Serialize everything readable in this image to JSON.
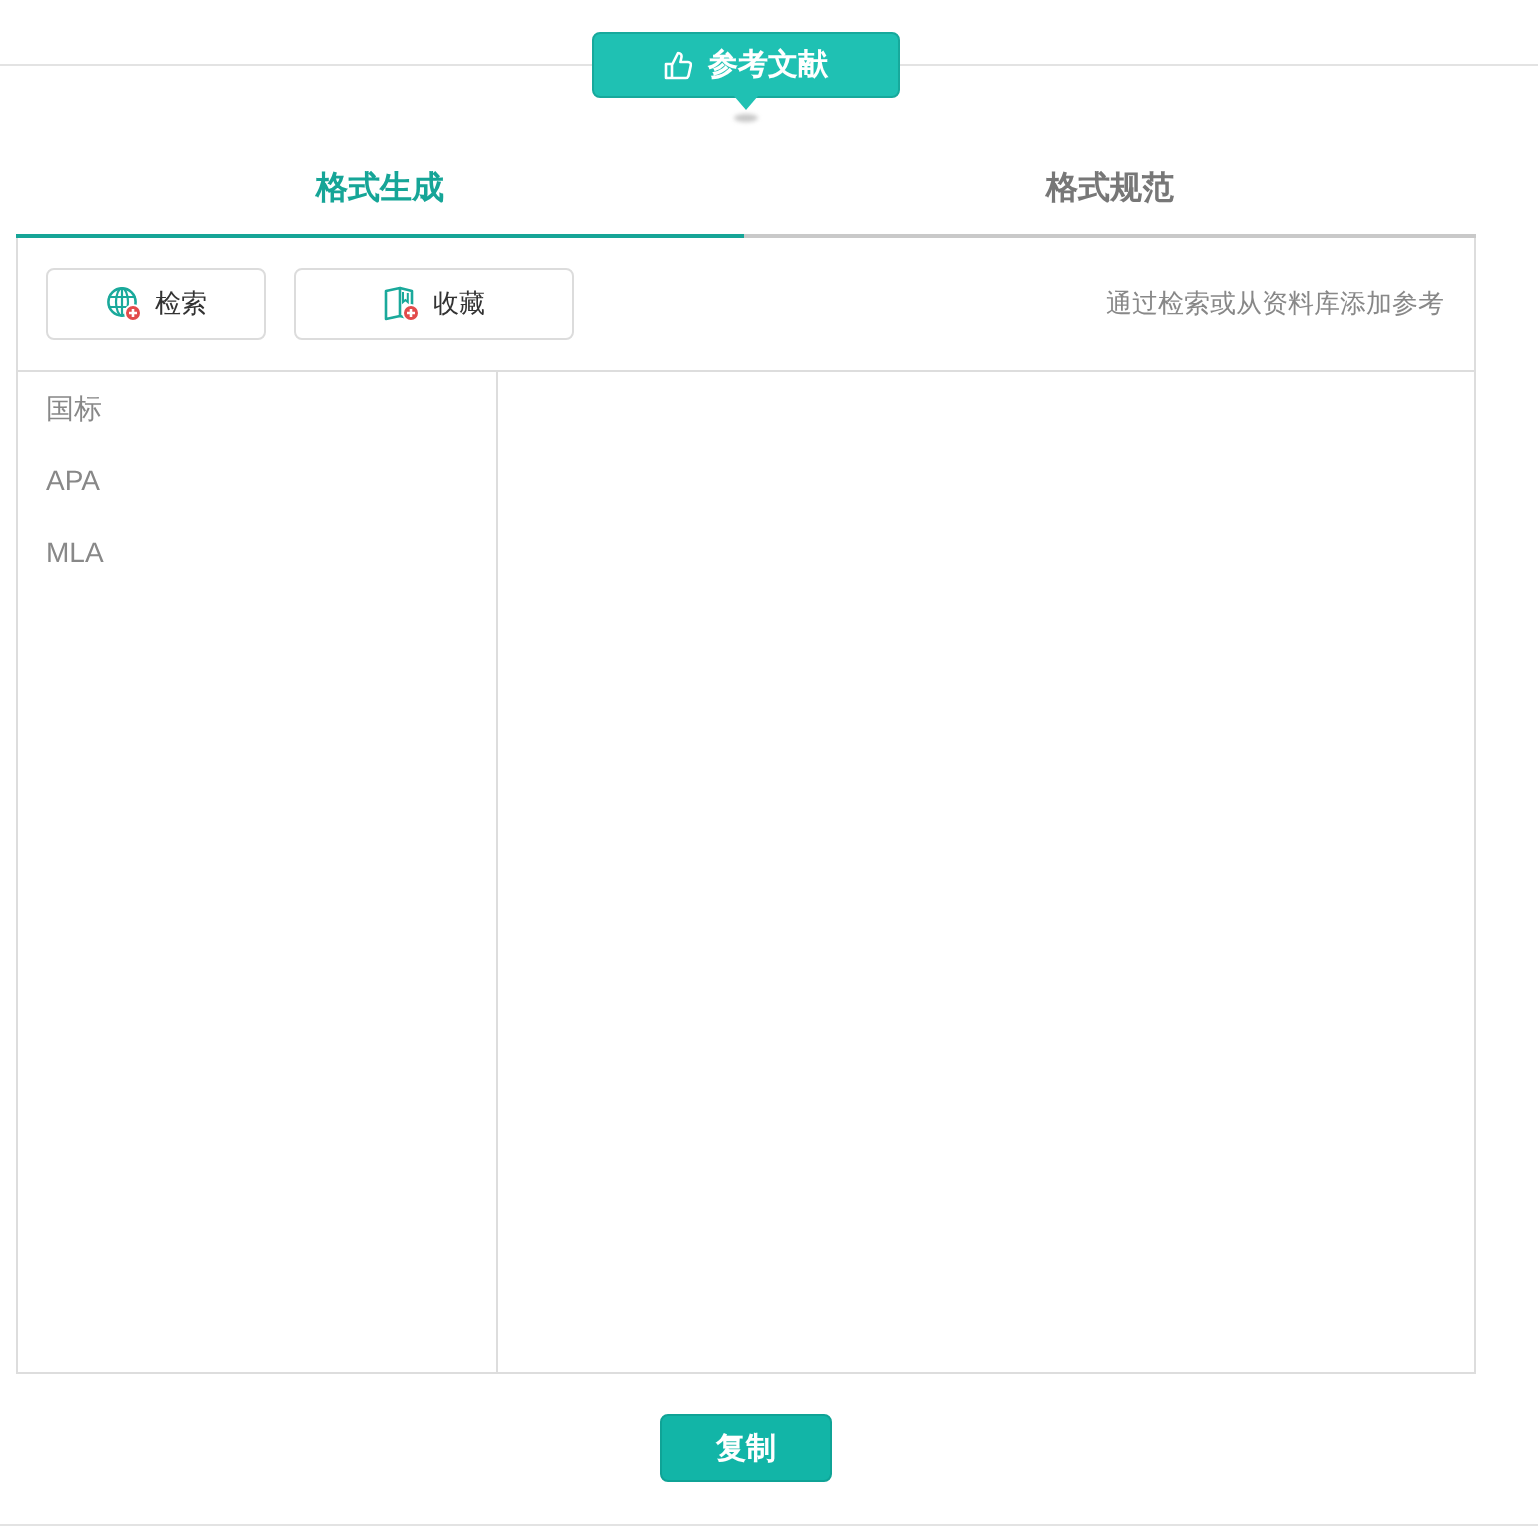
{
  "header": {
    "badge": {
      "label": "参考文献"
    }
  },
  "tabs": [
    {
      "label": "格式生成",
      "selected": true
    },
    {
      "label": "格式规范",
      "selected": false
    }
  ],
  "toolbar": {
    "buttons": [
      {
        "kind": "search",
        "label": "检索"
      },
      {
        "kind": "favorites",
        "label": "收藏"
      }
    ],
    "hint": "通过检索或从资料库添加参考"
  },
  "styles": [
    {
      "label": "国标",
      "selected": false
    },
    {
      "label": "APA",
      "selected": false
    },
    {
      "label": "MLA",
      "selected": false
    }
  ],
  "actions": {
    "copy": "复制"
  }
}
